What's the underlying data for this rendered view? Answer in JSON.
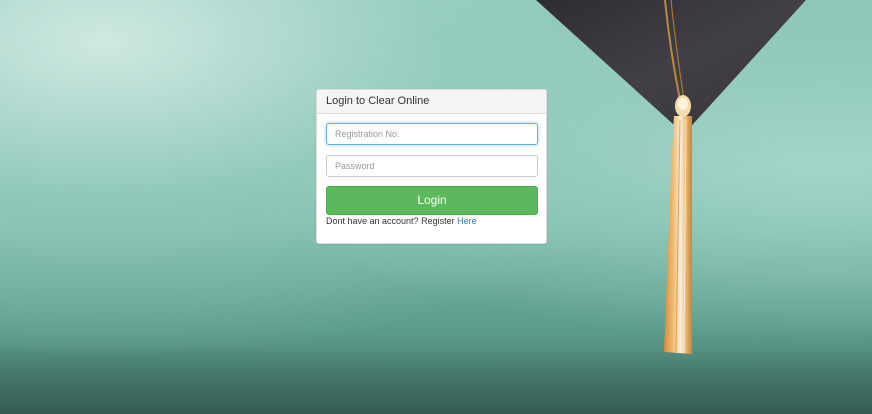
{
  "login_panel": {
    "title": "Login to Clear Online",
    "registration_placeholder": "Registration No.",
    "password_placeholder": "Password",
    "login_label": "Login",
    "register_prompt": "Dont have an account? Register",
    "register_link": "Here"
  },
  "colors": {
    "button": "#5cb85c",
    "link": "#337ab7",
    "focus_border": "#66afe9",
    "cap": "#3d3b41",
    "tassel": "#e0a75b"
  }
}
